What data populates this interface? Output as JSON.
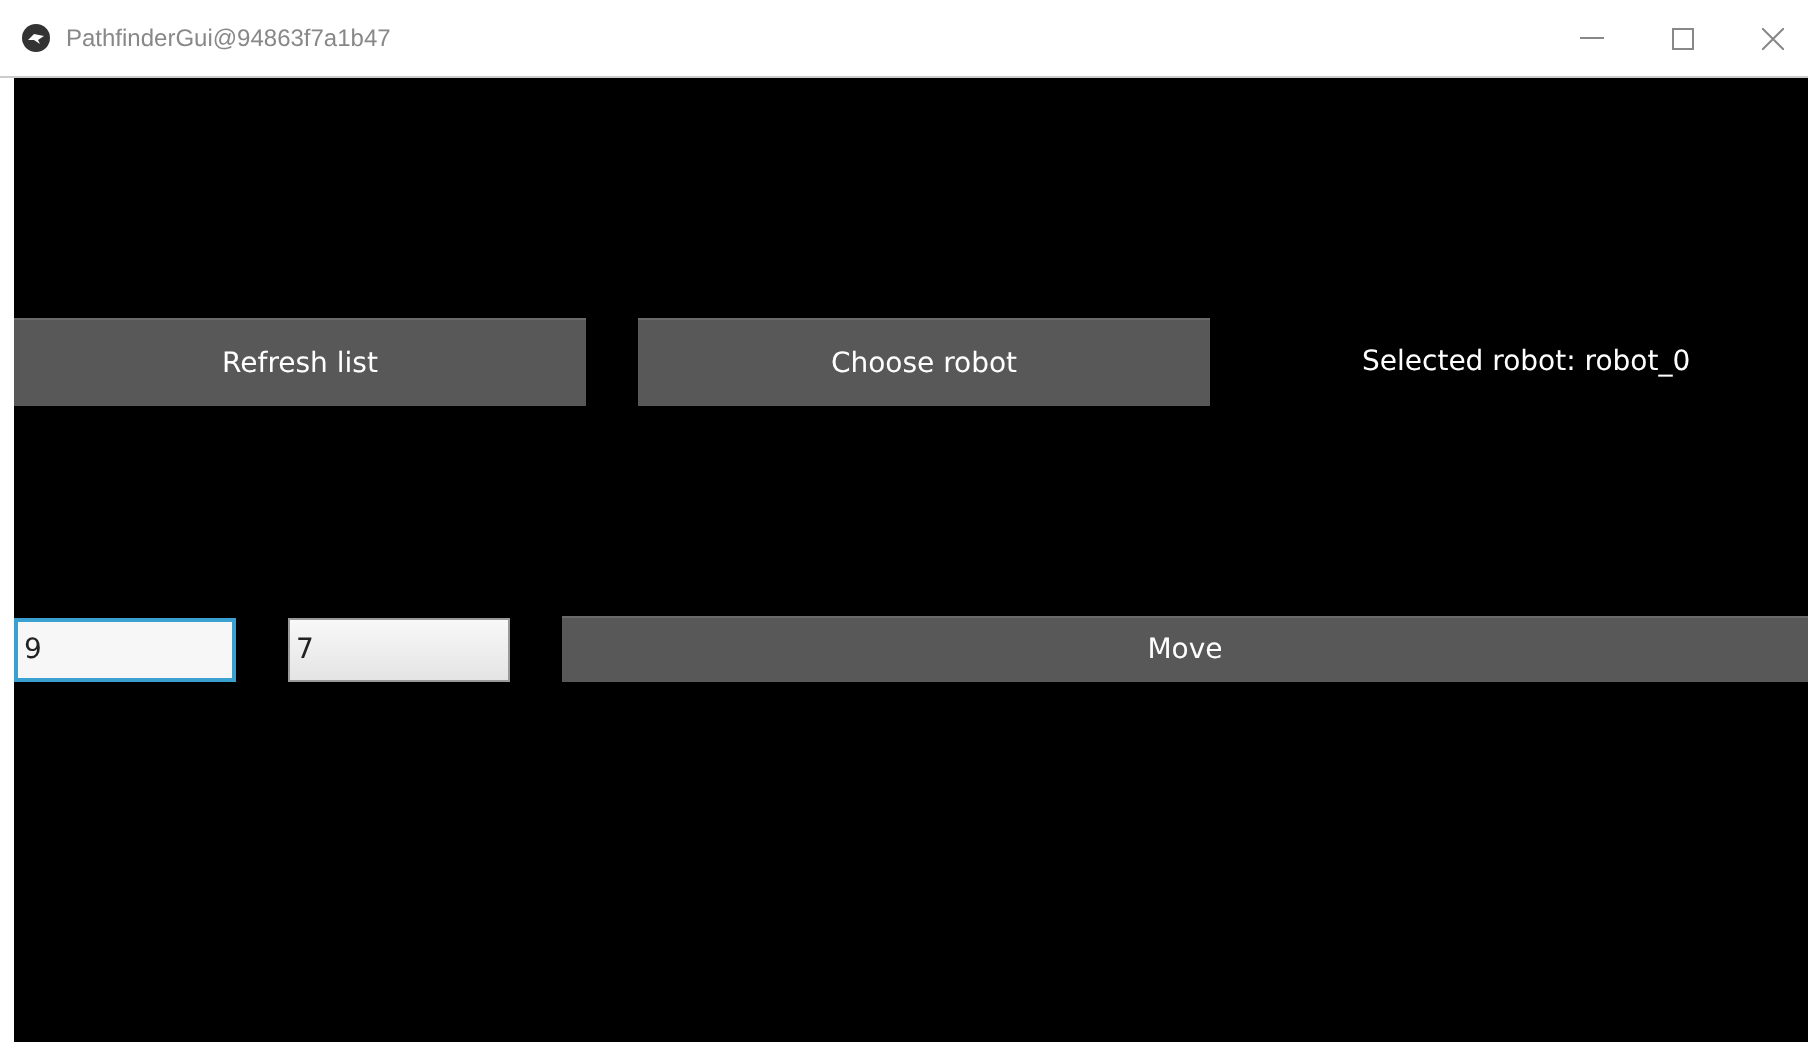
{
  "window": {
    "title": "PathfinderGui@94863f7a1b47"
  },
  "top_row": {
    "buttons": [
      "Refresh list",
      "Choose robot"
    ],
    "selected_label": "Selected robot: robot_0"
  },
  "move_row": {
    "fields": [
      {
        "value": "9",
        "focused": true
      },
      {
        "value": "7",
        "focused": false
      }
    ],
    "button": "Move"
  }
}
